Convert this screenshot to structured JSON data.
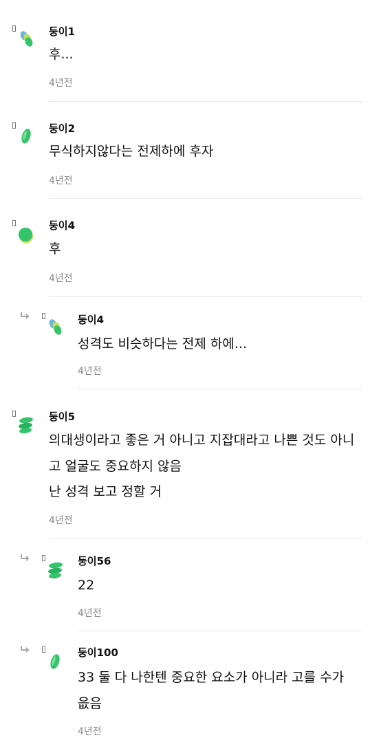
{
  "comments": [
    {
      "author": "둥이1",
      "lines": [
        "후..."
      ],
      "time": "4년전",
      "is_reply": false,
      "avatar_icon": "green-blue-bubble-avatar-icon"
    },
    {
      "author": "둥이2",
      "lines": [
        "무식하지않다는 전제하에 후자"
      ],
      "time": "4년전",
      "is_reply": false,
      "avatar_icon": "green-leaf-avatar-icon"
    },
    {
      "author": "둥이4",
      "lines": [
        "후"
      ],
      "time": "4년전",
      "is_reply": false,
      "avatar_icon": "green-oval-avatar-icon"
    },
    {
      "author": "둥이4",
      "lines": [
        "성격도 비슷하다는 전제 하에..."
      ],
      "time": "4년전",
      "is_reply": true,
      "avatar_icon": "green-blue-bubble-avatar-icon"
    },
    {
      "author": "둥이5",
      "lines": [
        "의대생이라고 좋은 거 아니고 지잡대라고 나쁜 것도 아니",
        "고 얼굴도 중요하지 않음",
        "난 성격 보고 정할 거"
      ],
      "time": "4년전",
      "is_reply": false,
      "avatar_icon": "green-stack-avatar-icon"
    },
    {
      "author": "둥이56",
      "lines": [
        "22"
      ],
      "time": "4년전",
      "is_reply": true,
      "avatar_icon": "green-stack-avatar-icon"
    },
    {
      "author": "둥이100",
      "lines": [
        "33 둘 다 나한텐 중요한 요소가 아니라 고를 수가",
        "읎음"
      ],
      "time": "4년전",
      "is_reply": true,
      "avatar_icon": "green-leaf-avatar-icon"
    }
  ],
  "colors": {
    "text": "#111111",
    "time": "#8a8a8a",
    "divider": "#e9e9e9",
    "avatar_green": "#35c36b",
    "avatar_blue": "#6fb6df"
  }
}
